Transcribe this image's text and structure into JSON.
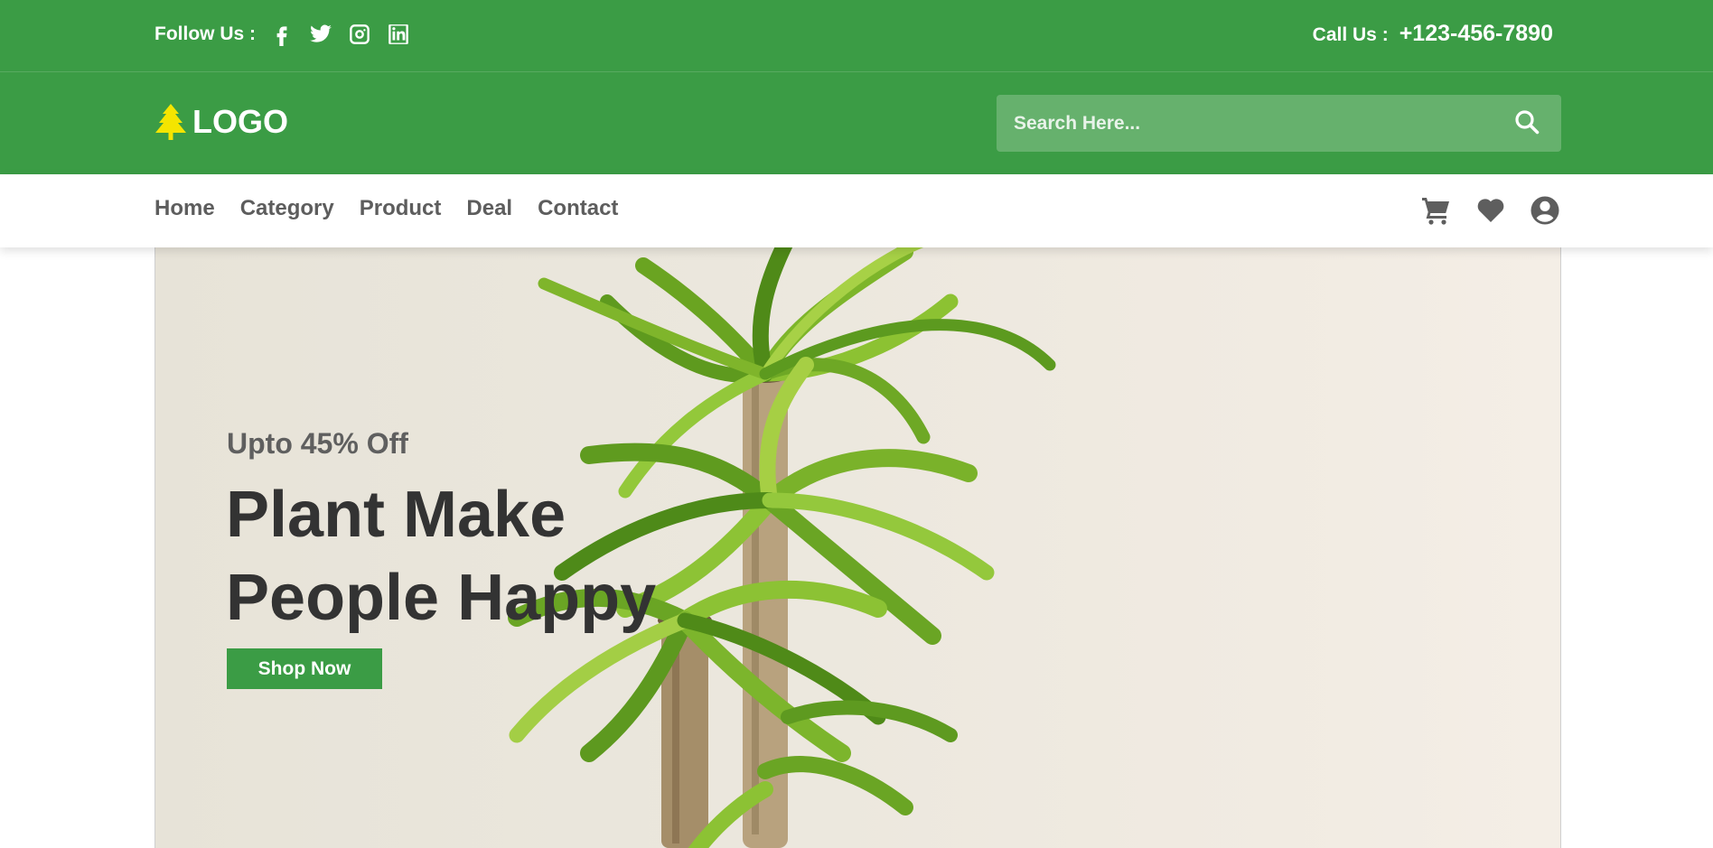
{
  "topbar": {
    "follow_label": "Follow Us :",
    "social_icons": [
      "facebook-icon",
      "twitter-icon",
      "instagram-icon",
      "linkedin-icon"
    ],
    "call_label": "Call Us :",
    "phone": "+123-456-7890"
  },
  "header": {
    "logo_text": "LOGO",
    "logo_icon": "tree-icon",
    "search_placeholder": "Search Here...",
    "search_icon": "search-icon"
  },
  "nav": {
    "items": [
      {
        "label": "Home"
      },
      {
        "label": "Category"
      },
      {
        "label": "Product"
      },
      {
        "label": "Deal"
      },
      {
        "label": "Contact"
      }
    ],
    "icons": [
      "cart-icon",
      "heart-icon",
      "user-account-icon"
    ]
  },
  "hero": {
    "offer": "Upto 45% Off",
    "title_line1": "Plant Make",
    "title_line2": "People Happy",
    "cta": "Shop Now"
  },
  "colors": {
    "brand_green": "#3b9c45",
    "text_dark": "#333333",
    "text_muted": "#5f5f5f",
    "logo_icon": "#f4e500",
    "hero_bg": "#ebe7dd"
  }
}
